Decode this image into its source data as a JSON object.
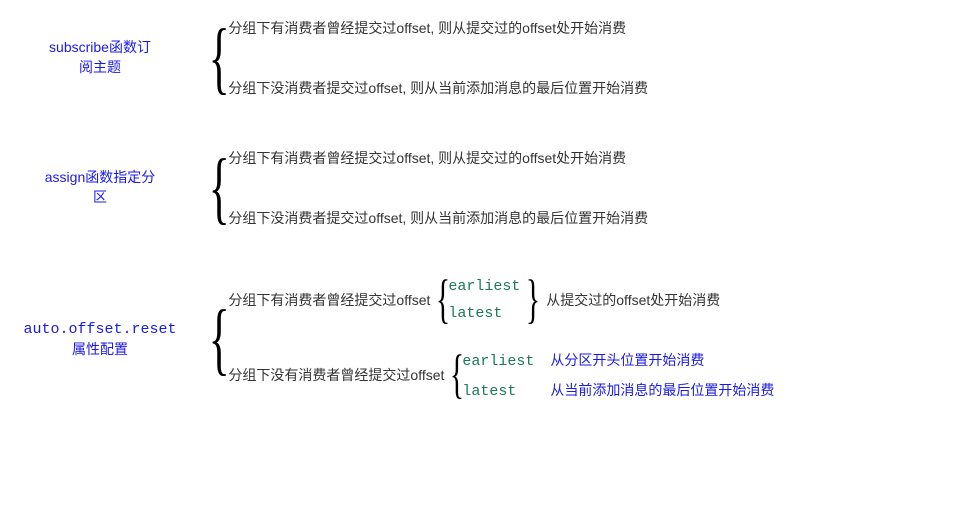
{
  "sections": [
    {
      "label_line1": "subscribe函数订",
      "label_line2": "阅主题",
      "branches": [
        "分组下有消费者曾经提交过offset, 则从提交过的offset处开始消费",
        "分组下没消费者提交过offset, 则从当前添加消息的最后位置开始消费"
      ]
    },
    {
      "label_line1": "assign函数指定分",
      "label_line2": "区",
      "branches": [
        "分组下有消费者曾经提交过offset, 则从提交过的offset处开始消费",
        "分组下没消费者提交过offset, 则从当前添加消息的最后位置开始消费"
      ]
    },
    {
      "label_line1": "auto.offset.reset",
      "label_line2": "属性配置",
      "branch1_prefix": "分组下有消费者曾经提交过offset",
      "branch1_options": [
        "earliest",
        "latest"
      ],
      "branch1_result": "从提交过的offset处开始消费",
      "branch2_prefix": "分组下没有消费者曾经提交过offset",
      "branch2_options": [
        {
          "opt": "earliest",
          "desc": "从分区开头位置开始消费"
        },
        {
          "opt": "latest",
          "desc": "从当前添加消息的最后位置开始消费"
        }
      ]
    }
  ]
}
